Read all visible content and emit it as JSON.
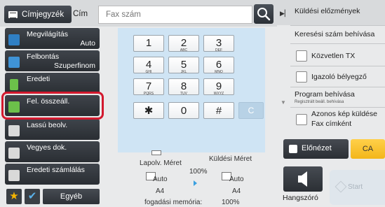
{
  "header": {
    "address_book_label": "Címjegyzék",
    "to_label": "Cím",
    "fax_placeholder": "Fax szám"
  },
  "sidebar": {
    "items": [
      {
        "label": "Megvilágítás",
        "value": "Auto",
        "icon_color": "#4ea3e0",
        "icon": "exposure-icon"
      },
      {
        "label": "Felbontás",
        "value": "Szuperfinom",
        "icon_color": "#4ea3e0",
        "icon": "resolution-icon"
      },
      {
        "label": "Eredeti",
        "value": "",
        "icon_color": "#6cc04a",
        "icon": "original-icon"
      },
      {
        "label": "Fel. összeáll.",
        "value": "",
        "icon_color": "#6cc04a",
        "icon": "program-icon"
      },
      {
        "label": "Lassú beolv.",
        "value": "",
        "icon_color": "#e0e0e0",
        "icon": "slow-scan-icon"
      },
      {
        "label": "Vegyes dok.",
        "value": "",
        "icon_color": "#e0e0e0",
        "icon": "mixed-size-icon"
      },
      {
        "label": "Eredeti számlálás",
        "value": "",
        "icon_color": "#e0e0e0",
        "icon": "original-count-icon"
      }
    ],
    "egyeb_label": "Egyéb"
  },
  "keypad": {
    "keys": [
      {
        "num": "1",
        "sub": ""
      },
      {
        "num": "2",
        "sub": "ABC"
      },
      {
        "num": "3",
        "sub": "DEF"
      },
      {
        "num": "4",
        "sub": "GHI"
      },
      {
        "num": "5",
        "sub": "JKL"
      },
      {
        "num": "6",
        "sub": "MNO"
      },
      {
        "num": "7",
        "sub": "PQRS"
      },
      {
        "num": "8",
        "sub": "TUV"
      },
      {
        "num": "9",
        "sub": "WXYZ"
      },
      {
        "num": "✱",
        "sub": ""
      },
      {
        "num": "0",
        "sub": ""
      },
      {
        "num": "#",
        "sub": ""
      }
    ],
    "clear_label": "C"
  },
  "status": {
    "lapolv_label": "Lapolv. Méret",
    "kuldesi_label": "Küldési Méret",
    "left_auto": "Auto",
    "percent_mid": "100%",
    "right_auto": "Auto",
    "left_size": "A4",
    "right_size": "A4",
    "memory_label": "fogadási memória:",
    "memory_value": "100%"
  },
  "right_panel": {
    "history_label": "Küldési előzmények",
    "recall_label": "Keresési szám behívása",
    "direct_tx_label": "Közvetlen TX",
    "verification_label": "Igazoló bélyegző",
    "program_recall_label": "Program behívása",
    "program_recall_sub": "Regisztrált beáll. behívása",
    "same_image_label_1": "Azonos kép küldése",
    "same_image_label_2": "Fax címként",
    "preview_label": "Előnézet",
    "ca_label": "CA",
    "speaker_label": "Hangszóró",
    "start_label": "Start"
  }
}
